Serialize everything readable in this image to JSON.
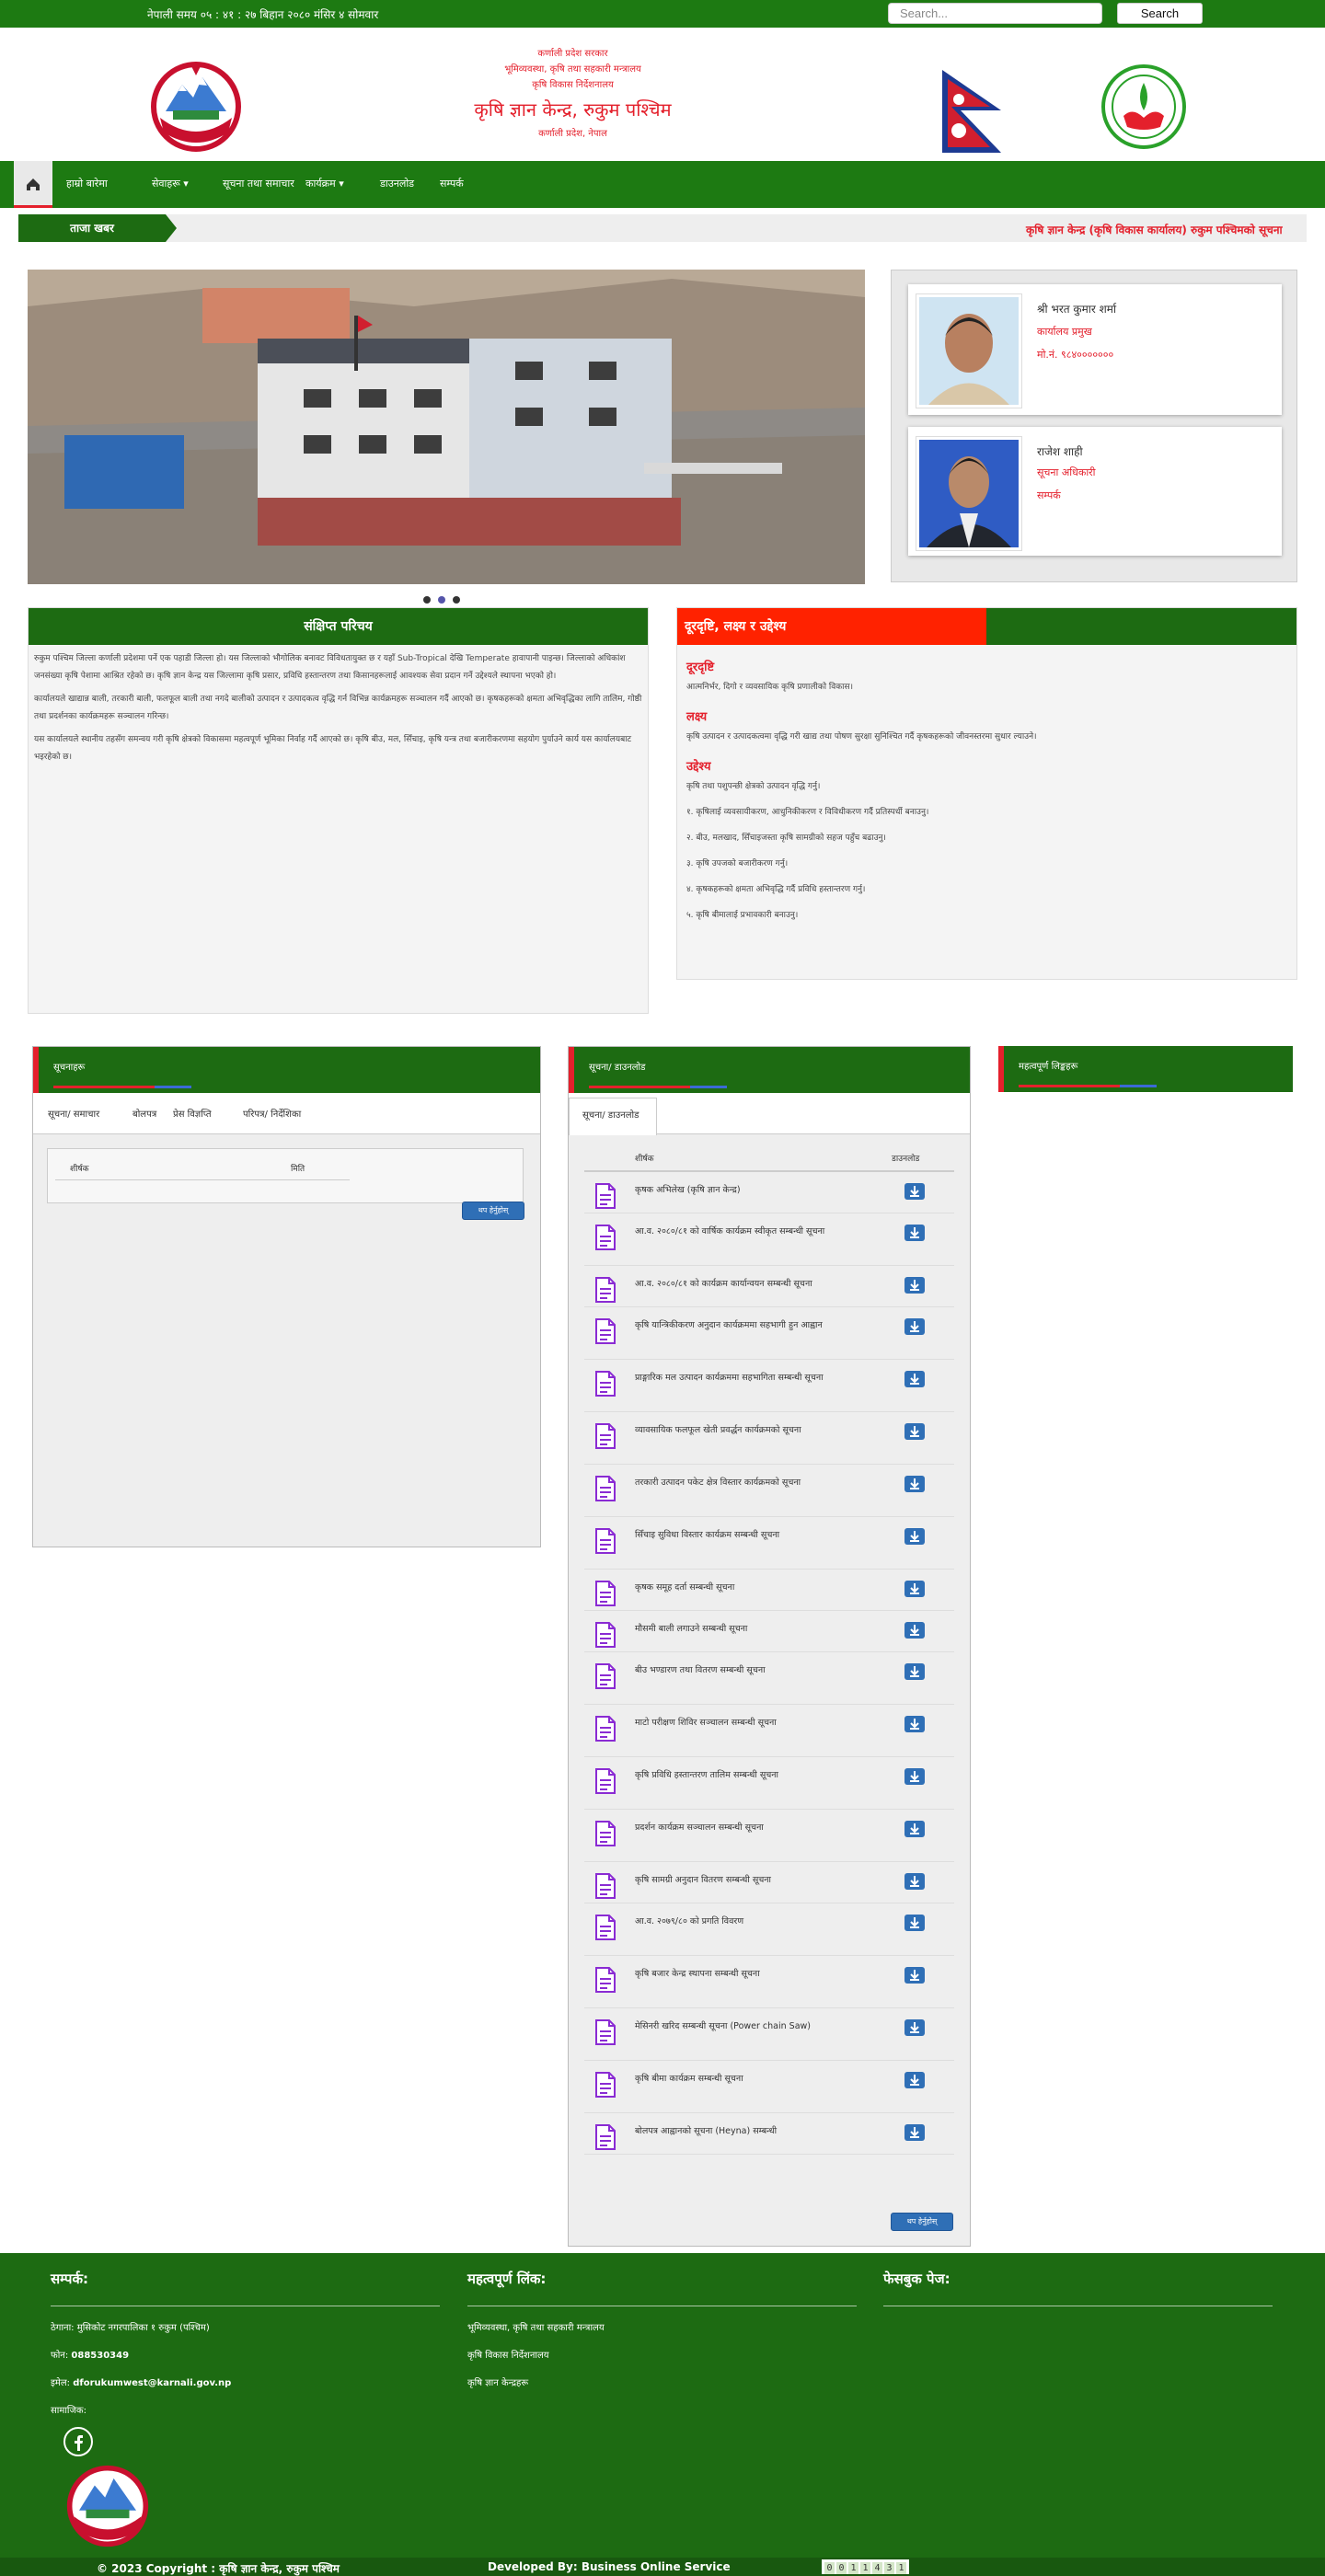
{
  "topbar": {
    "time": "नेपाली समय ०५ : ४१ : २७ बिहान   २०८० मंसिर ४ सोमवार",
    "search_placeholder": "Search...",
    "search_button": "Search"
  },
  "header": {
    "line1": "कर्णाली प्रदेश सरकार",
    "line2": "भूमिव्यवस्था, कृषि तथा सहकारी मन्त्रालय",
    "line3": "कृषि विकास निर्देशनालय",
    "title": "कृषि ज्ञान केन्द्र, रुकुम पश्चिम",
    "location": "कर्णाली प्रदेश, नेपाल"
  },
  "nav": {
    "items": [
      "हाम्रो बारेमा",
      "सेवाहरू",
      "सूचना तथा समाचार",
      "कार्यक्रम",
      "डाउनलोड",
      "सम्पर्क"
    ],
    "dropdown_flags": [
      false,
      true,
      false,
      true,
      false,
      false
    ]
  },
  "ticker": {
    "label": "ताजा खबर",
    "message": "कृषि ज्ञान केन्द्र (कृषि विकास कार्यालय) रुकुम पश्चिमको सूचना"
  },
  "slider": {
    "active_index": 1,
    "count": 3
  },
  "officials": [
    {
      "name": "श्री भरत कुमार शर्मा",
      "role": "कार्यालय प्रमुख",
      "detail": "मो.नं. ९८४०००००००"
    },
    {
      "name": "राजेश शाही",
      "role": "सूचना अधिकारी",
      "detail": "सम्पर्क"
    }
  ],
  "intro": {
    "title": "संक्षिप्त परिचय",
    "paragraphs": [
      "रुकुम पश्चिम जिल्ला कर्णाली प्रदेशमा पर्ने एक पहाडी जिल्ला हो। यस जिल्लाको भौगोलिक बनावट विविधतायुक्त छ र यहाँ Sub-Tropical देखि Temperate हावापानी पाइन्छ। जिल्लाको अधिकांश जनसंख्या कृषि पेशामा आश्रित रहेको छ। कृषि ज्ञान केन्द्र यस जिल्लामा कृषि प्रसार, प्रविधि हस्तान्तरण तथा किसानहरूलाई आवश्यक सेवा प्रदान गर्ने उद्देश्यले स्थापना भएको हो।",
      "कार्यालयले खाद्यान्न बाली, तरकारी बाली, फलफूल बाली तथा नगदे बालीको उत्पादन र उत्पादकत्व वृद्धि गर्न विभिन्न कार्यक्रमहरू सञ्चालन गर्दै आएको छ। कृषकहरूको क्षमता अभिवृद्धिका लागि तालिम, गोष्ठी तथा प्रदर्शनका कार्यक्रमहरू सञ्चालन गरिन्छ।",
      "यस कार्यालयले स्थानीय तहसँग समन्वय गरी कृषि क्षेत्रको विकासमा महत्वपूर्ण भूमिका निर्वाह गर्दै आएको छ। कृषि बीउ, मल, सिँचाइ, कृषि यन्त्र तथा बजारीकरणमा सहयोग पुर्याउने कार्य यस कार्यालयबाट भइरहेको छ।"
    ]
  },
  "mission": {
    "title": "दूरदृष्टि, लक्ष्य र उद्देश्य",
    "sections": [
      {
        "heading": "दूरदृष्टि",
        "lines": [
          "आत्मनिर्भर, दिगो र व्यवसायिक कृषि प्रणालीको विकास।"
        ]
      },
      {
        "heading": "लक्ष्य",
        "lines": [
          "कृषि उत्पादन र उत्पादकत्वमा वृद्धि गरी खाद्य तथा पोषण सुरक्षा सुनिश्चित गर्दै कृषकहरूको जीवनस्तरमा सुधार ल्याउने।"
        ]
      },
      {
        "heading": "उद्देश्य",
        "lines": [
          "कृषि तथा पशुपन्छी क्षेत्रको उत्पादन वृद्धि गर्नु।",
          "१. कृषिलाई व्यवसायीकरण, आधुनिकीकरण र विविधीकरण गर्दै प्रतिस्पर्धी बनाउनु।",
          "२. बीउ, मलखाद, सिँचाइजस्ता कृषि सामग्रीको सहज पहुँच बढाउनु।",
          "३. कृषि उपजको बजारीकरण गर्नु।",
          "४. कृषकहरूको क्षमता अभिवृद्धि गर्दै प्रविधि हस्तान्तरण गर्नु।",
          "५. कृषि बीमालाई प्रभावकारी बनाउनु।"
        ]
      }
    ]
  },
  "notices": {
    "title": "सूचनाहरू",
    "tabs": [
      "सूचना/ समाचार",
      "बोलपत्र",
      "प्रेस विज्ञप्ति",
      "परिपत्र/ निर्देशिका"
    ],
    "columns": [
      "शीर्षक",
      "मिति"
    ],
    "more_button": "थप हेर्नुहोस्"
  },
  "downloads": {
    "title": "सूचना/ डाउनलोड",
    "tab": "सूचना/ डाउनलोड",
    "columns": [
      "शीर्षक",
      "डाउनलोड"
    ],
    "rows": [
      "कृषक अभिलेख (कृषि ज्ञान केन्द्र)",
      "आ.व. २०८०/८१ को वार्षिक कार्यक्रम स्वीकृत सम्बन्धी सूचना",
      "आ.व. २०८०/८१ को कार्यक्रम कार्यान्वयन सम्बन्धी सूचना",
      "कृषि यान्त्रिकीकरण अनुदान कार्यक्रममा सहभागी हुन आह्वान",
      "प्राङ्गारिक मल उत्पादन कार्यक्रममा सहभागिता सम्बन्धी सूचना",
      "व्यावसायिक फलफूल खेती प्रवर्द्धन कार्यक्रमको सूचना",
      "तरकारी उत्पादन पकेट क्षेत्र विस्तार कार्यक्रमको सूचना",
      "सिँचाइ सुविधा विस्तार कार्यक्रम सम्बन्धी सूचना",
      "कृषक समूह दर्ता सम्बन्धी सूचना",
      "मौसमी बाली लगाउने सम्बन्धी सूचना",
      "बीउ भण्डारण तथा वितरण सम्बन्धी सूचना",
      "माटो परीक्षण शिविर सञ्चालन सम्बन्धी सूचना",
      "कृषि प्रविधि हस्तान्तरण तालिम सम्बन्धी सूचना",
      "प्रदर्शन कार्यक्रम सञ्चालन सम्बन्धी सूचना",
      "कृषि सामग्री अनुदान वितरण सम्बन्धी सूचना",
      "आ.व. २०७९/८० को प्रगति विवरण",
      "कृषि बजार केन्द्र स्थापना सम्बन्धी सूचना",
      "मेसिनरी खरिद सम्बन्धी सूचना (Power chain Saw)",
      "कृषि बीमा कार्यक्रम सम्बन्धी सूचना",
      "बोलपत्र आह्वानको सूचना (Heyna) सम्बन्धी"
    ],
    "more_button": "थप हेर्नुहोस्"
  },
  "widget3": {
    "title": "महत्वपूर्ण लिङ्कहरू"
  },
  "footer": {
    "contact_title": "सम्पर्क:",
    "address": "ठेगाना: मुसिकोट नगरपालिका १ रुकुम (पश्चिम)",
    "phone_label": "फोन:",
    "phone": "088530349",
    "email_label": "इमेल:",
    "email": "dforukumwest@karnali.gov.np",
    "social_label": "सामाजिक:",
    "links_title": "महत्वपूर्ण लिंक:",
    "links": [
      "भूमिव्यवस्था, कृषि तथा सहकारी मन्त्रालय",
      "कृषि विकास निर्देशनालय",
      "कृषि ज्ञान केन्द्रहरू"
    ],
    "page_title": "फेसबुक पेज:"
  },
  "copyright": {
    "text": "© 2023 Copyright :",
    "owner": "कृषि ज्ञान केन्द्र, रुकुम पश्चिम",
    "developer": "Developed By: Business Online Service",
    "counter": "0011431"
  }
}
